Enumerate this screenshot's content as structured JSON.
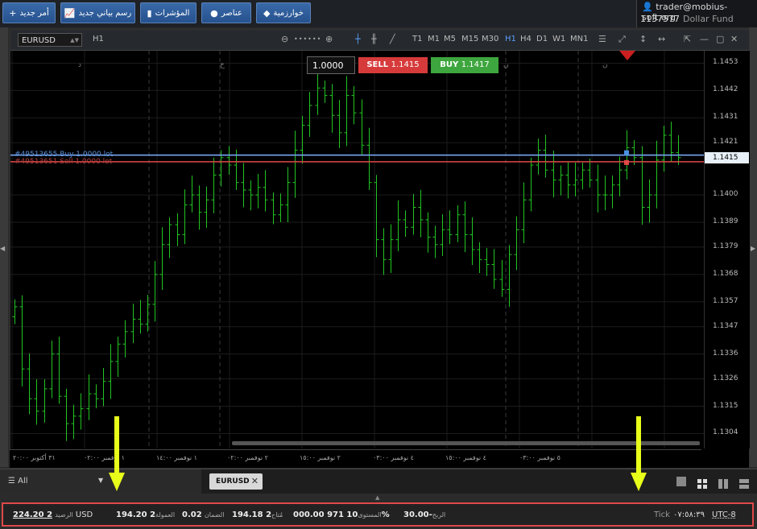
{
  "toolbar": {
    "new_order": "أمر جديد",
    "new_chart": "رسم بياني جديد",
    "indicators": "المؤشرات",
    "elements": "عناصر",
    "algorithm": "خوارزمية"
  },
  "account": {
    "email": "trader@mobius-soft.org",
    "number": "1137577",
    "fund": "Dollar Fund"
  },
  "chart": {
    "symbol": "EURUSD",
    "timeframe": "H1",
    "timeframes": [
      "T1",
      "M1",
      "M5",
      "M15",
      "M30",
      "H1",
      "H4",
      "D1",
      "W1",
      "MN1"
    ],
    "active_timeframe": "H1",
    "quantity": "1.0000",
    "sell_label": "SELL",
    "sell_price": "1.1415",
    "buy_label": "BUY",
    "buy_price": "1.1417",
    "order_buy": "#49513655 Buy 1.0000 lot",
    "order_sell": "#49513651 Sell 1.0000 lot",
    "current_price_tag": "1.1415",
    "period_letters": [
      "د",
      "خ",
      "ن",
      "ن"
    ]
  },
  "chart_data": {
    "type": "candlestick",
    "y_ticks": [
      "1.1453",
      "1.1442",
      "1.1431",
      "1.1421",
      "1.1400",
      "1.1389",
      "1.1379",
      "1.1368",
      "1.1357",
      "1.1347",
      "1.1336",
      "1.1326",
      "1.1315",
      "1.1304"
    ],
    "ylim": [
      1.1298,
      1.1458
    ],
    "x_ticks": [
      "٣١ أكتوبر ٢٠:٠٠",
      "١ نوفمبر ٠٢:٠٠",
      "١ نوفمبر ١٤:٠٠",
      "٢ نوفمبر ٠٢:٠٠",
      "٢ نوفمبر ١٥:٠٠",
      "٤ نوفمبر ٠٣:٠٠",
      "٤ نوفمبر ١٥:٠٠",
      "٥ نوفمبر ٠٣:٠٠"
    ],
    "closes": [
      1.1355,
      1.133,
      1.1318,
      1.1313,
      1.1322,
      1.1336,
      1.1319,
      1.1308,
      1.1311,
      1.1314,
      1.132,
      1.1318,
      1.1325,
      1.1333,
      1.134,
      1.1345,
      1.135,
      1.1348,
      1.1356,
      1.1368,
      1.138,
      1.1388,
      1.1384,
      1.1396,
      1.14,
      1.1393,
      1.1398,
      1.1408,
      1.1415,
      1.1412,
      1.1405,
      1.1402,
      1.14,
      1.1403,
      1.1398,
      1.1392,
      1.1396,
      1.1405,
      1.1418,
      1.1428,
      1.1436,
      1.1443,
      1.144,
      1.1432,
      1.1425,
      1.144,
      1.1433,
      1.142,
      1.1405,
      1.1382,
      1.1374,
      1.1382,
      1.139,
      1.1387,
      1.1395,
      1.139,
      1.1383,
      1.138,
      1.1386,
      1.1384,
      1.1392,
      1.1384,
      1.1378,
      1.1374,
      1.1372,
      1.1366,
      1.1362,
      1.1376,
      1.1386,
      1.1398,
      1.1412,
      1.1418,
      1.141,
      1.1406,
      1.1408,
      1.1404,
      1.1406,
      1.141,
      1.1406,
      1.14,
      1.14,
      1.1404,
      1.141,
      1.1419,
      1.1415,
      1.1395,
      1.14,
      1.1414,
      1.1424,
      1.1417,
      1.1415
    ]
  },
  "tabs": {
    "filter": "All",
    "symbol_tab": "EURUSD"
  },
  "status": {
    "balance_value": "224.20 2",
    "balance_label": "الرصيد",
    "currency": "USD",
    "equity_value": "194.20 2",
    "equity_label": "العمولة",
    "margin_value": "0.02",
    "margin_label": "الضمان",
    "free_value": "194.18 2",
    "free_label": "مُتاح",
    "level_value": "000.00 971 10",
    "level_label": "المستوى",
    "percent": "%",
    "profit_value": "30.00-",
    "profit_label": "الربح",
    "tick_label": "Tick",
    "time": "٠٧:٥٨:٣٩",
    "timezone": "UTC-8"
  },
  "colors": {
    "candle": "#22c422",
    "buy_line": "#7fb0ff",
    "sell_line": "#e04848",
    "highlight_border": "#e04848",
    "annotation_arrow": "#e8ff1a"
  }
}
